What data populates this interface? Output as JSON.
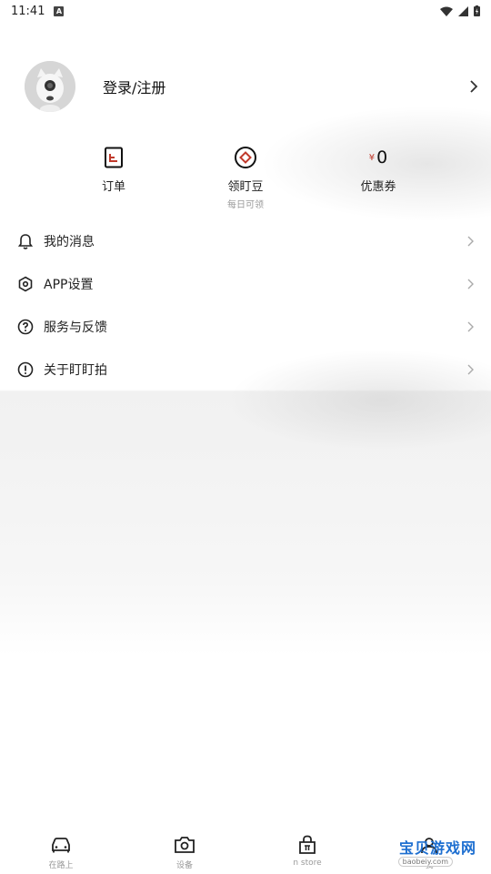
{
  "status_bar": {
    "time": "11:41",
    "badge": "A",
    "icons": [
      "wifi-icon",
      "signal-icon",
      "battery-icon"
    ]
  },
  "profile": {
    "login_label": "登录/注册"
  },
  "quick_actions": [
    {
      "label": "订单",
      "icon": "order-list-icon"
    },
    {
      "label": "领盯豆",
      "sub": "每日可领",
      "icon": "diamond-coin-icon"
    },
    {
      "label": "优惠券",
      "currency": "¥",
      "value": "0"
    }
  ],
  "menu": [
    {
      "label": "我的消息",
      "icon": "bell-icon"
    },
    {
      "label": "APP设置",
      "icon": "hexagon-settings-icon"
    },
    {
      "label": "服务与反馈",
      "icon": "question-circle-icon"
    },
    {
      "label": "关于盯盯拍",
      "icon": "info-exclamation-icon"
    }
  ],
  "tabbar": [
    {
      "label": "在路上",
      "icon": "car-icon"
    },
    {
      "label": "设备",
      "icon": "camera-icon"
    },
    {
      "label": "n store",
      "icon": "store-bag-icon"
    },
    {
      "label": "我",
      "icon": "profile-icon"
    }
  ],
  "watermark": {
    "text": "宝贝游戏网",
    "sub": "baobeiy.com"
  },
  "colors": {
    "accent_red": "#c0392b",
    "text_primary": "#222222",
    "text_secondary": "#999999",
    "watermark_blue": "#1e6fd0"
  }
}
